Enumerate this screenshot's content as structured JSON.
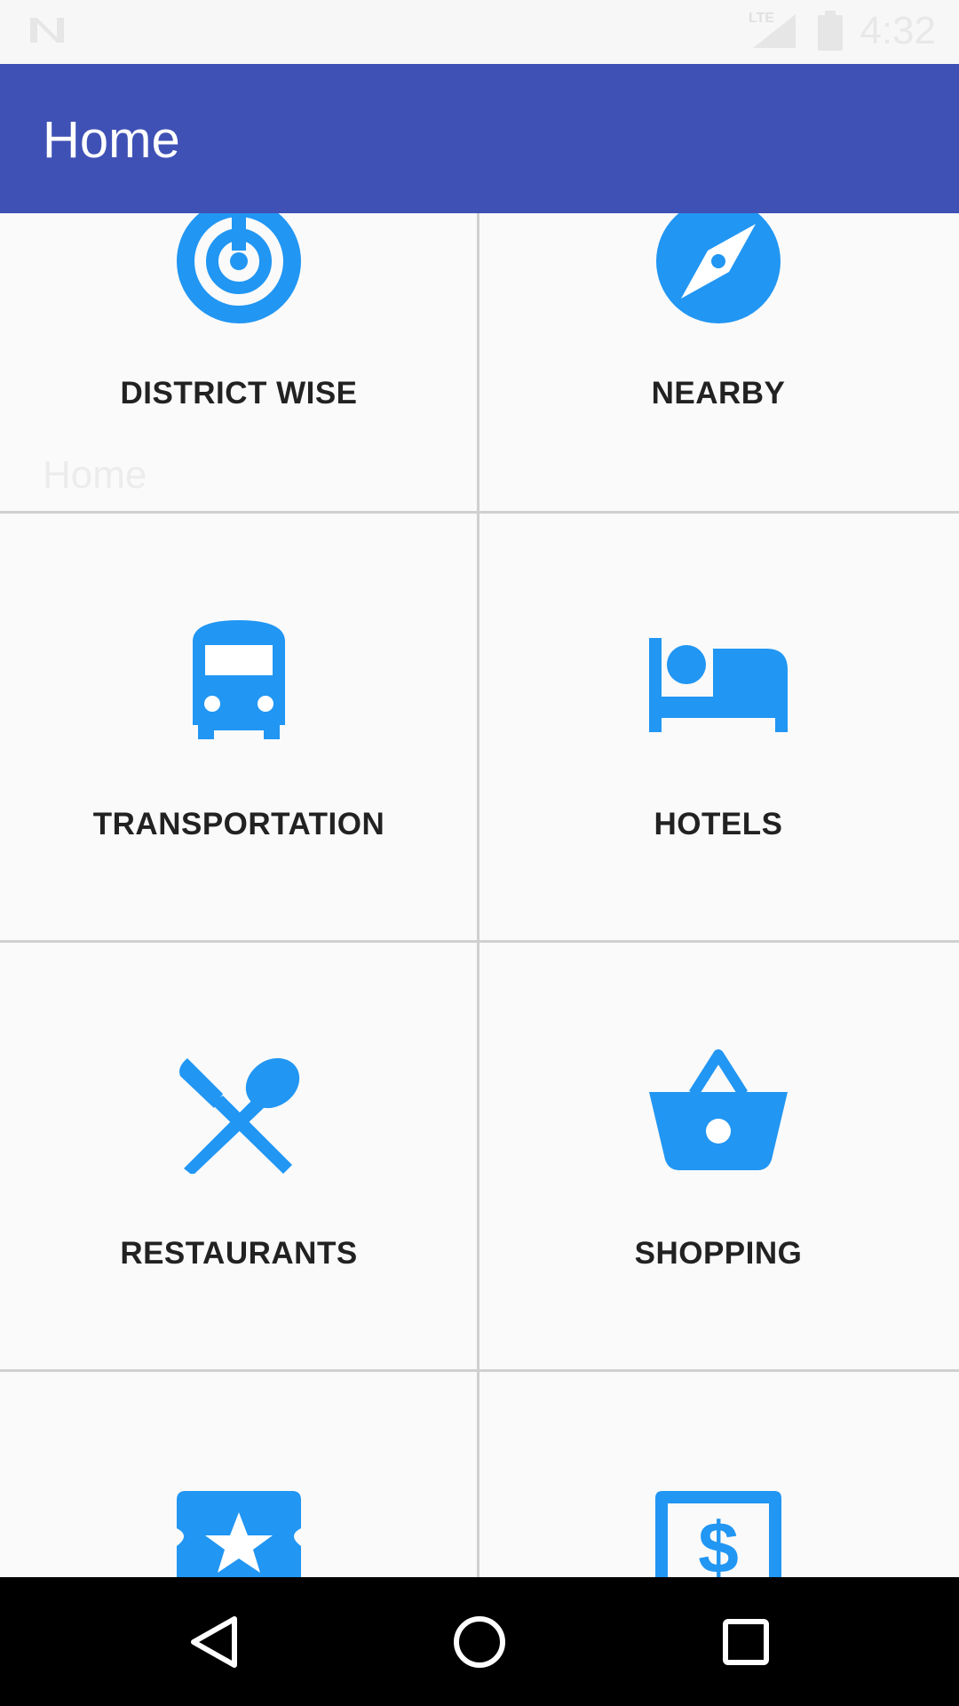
{
  "status_bar": {
    "time": "4:32",
    "network_label": "LTE",
    "icons": [
      "notification-n-icon",
      "signal-icon",
      "battery-icon"
    ]
  },
  "app_bar": {
    "title": "Home"
  },
  "ghost_title": "Home",
  "colors": {
    "primary": "#3f51b5",
    "icon_blue": "#2196f3",
    "label": "#222222",
    "divider": "#d0d0d0",
    "background": "#fafafa"
  },
  "tiles": [
    {
      "label": "DISTRICT WISE",
      "icon": "radar-icon"
    },
    {
      "label": "NEARBY",
      "icon": "compass-icon"
    },
    {
      "label": "TRANSPORTATION",
      "icon": "bus-icon"
    },
    {
      "label": "HOTELS",
      "icon": "bed-icon"
    },
    {
      "label": "RESTAURANTS",
      "icon": "restaurant-icon"
    },
    {
      "label": "SHOPPING",
      "icon": "basket-icon"
    },
    {
      "label": "",
      "icon": "ticket-star-icon"
    },
    {
      "label": "",
      "icon": "currency-icon"
    }
  ],
  "nav_bar": {
    "buttons": [
      "back-icon",
      "home-icon",
      "recents-icon"
    ]
  }
}
